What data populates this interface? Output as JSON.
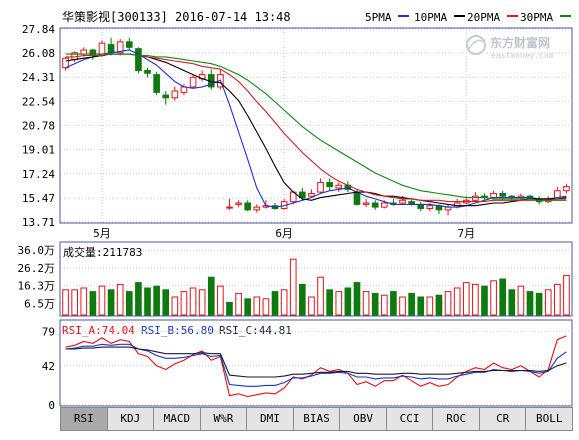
{
  "header": {
    "title": "华策影视[300133] 2016-07-14 13:48",
    "legend": [
      {
        "label": "5PMA",
        "color": "#2233cc"
      },
      {
        "label": "10PMA",
        "color": "#000000"
      },
      {
        "label": "20PMA",
        "color": "#cc2222"
      },
      {
        "label": "30PMA",
        "color": "#118811"
      }
    ],
    "watermark_cn": "东方财富网",
    "watermark_en": "eastmoney.com"
  },
  "colors": {
    "up": "#e0161b",
    "down": "#0f7a0f",
    "rsi_a": "#e01010",
    "rsi_b": "#1c36c6",
    "rsi_c": "#1b1b2e",
    "grid": "#c7cbe0"
  },
  "chart_data": [
    {
      "type": "candlestick",
      "y_ticks": [
        "27.84",
        "26.08",
        "24.31",
        "22.54",
        "20.78",
        "19.01",
        "17.24",
        "15.47",
        "13.71"
      ],
      "ylim": [
        13.71,
        27.84
      ],
      "x_tick_labels": [
        {
          "label": "5月",
          "index": 4
        },
        {
          "label": "6月",
          "index": 24
        },
        {
          "label": "7月",
          "index": 44
        }
      ],
      "candles": [
        [
          25.0,
          25.7,
          25.8,
          24.8
        ],
        [
          25.6,
          26.1,
          26.2,
          25.4
        ],
        [
          26.0,
          26.3,
          26.5,
          25.8
        ],
        [
          26.3,
          25.9,
          26.4,
          25.6
        ],
        [
          25.9,
          26.8,
          27.0,
          25.8
        ],
        [
          26.7,
          26.1,
          27.2,
          25.9
        ],
        [
          26.1,
          26.9,
          27.1,
          25.9
        ],
        [
          26.9,
          26.5,
          27.2,
          26.3
        ],
        [
          26.4,
          24.8,
          26.5,
          24.6
        ],
        [
          24.8,
          24.6,
          25.0,
          24.3
        ],
        [
          24.5,
          23.2,
          24.7,
          23.0
        ],
        [
          23.0,
          22.8,
          23.3,
          22.3
        ],
        [
          22.8,
          23.3,
          23.6,
          22.6
        ],
        [
          23.2,
          23.6,
          23.8,
          23.0
        ],
        [
          23.6,
          24.3,
          24.5,
          23.5
        ],
        [
          24.2,
          24.5,
          24.8,
          24.0
        ],
        [
          24.5,
          23.6,
          24.9,
          23.4
        ],
        [
          23.6,
          24.5,
          24.9,
          23.4
        ],
        [
          14.8,
          14.8,
          15.4,
          14.6
        ],
        [
          15.0,
          15.1,
          15.3,
          14.8
        ],
        [
          15.1,
          14.6,
          15.3,
          14.5
        ],
        [
          14.6,
          14.8,
          15.0,
          14.4
        ],
        [
          14.8,
          14.9,
          15.3,
          14.7
        ],
        [
          14.9,
          14.7,
          15.1,
          14.6
        ],
        [
          14.7,
          15.2,
          15.4,
          14.6
        ],
        [
          15.2,
          15.9,
          16.0,
          15.0
        ],
        [
          15.9,
          15.5,
          16.2,
          15.3
        ],
        [
          15.6,
          15.8,
          16.1,
          15.5
        ],
        [
          15.9,
          16.6,
          16.9,
          15.8
        ],
        [
          16.6,
          16.3,
          16.9,
          16.0
        ],
        [
          16.2,
          16.4,
          16.6,
          15.9
        ],
        [
          16.4,
          16.1,
          16.7,
          15.9
        ],
        [
          15.9,
          15.0,
          16.1,
          14.9
        ],
        [
          15.0,
          15.1,
          15.4,
          14.8
        ],
        [
          15.1,
          14.8,
          15.3,
          14.6
        ],
        [
          14.8,
          15.1,
          15.3,
          14.7
        ],
        [
          15.1,
          15.0,
          15.4,
          14.9
        ],
        [
          15.1,
          15.3,
          15.6,
          15.0
        ],
        [
          15.2,
          15.0,
          15.4,
          14.9
        ],
        [
          15.0,
          14.7,
          15.2,
          14.5
        ],
        [
          14.7,
          14.9,
          15.1,
          14.5
        ],
        [
          14.9,
          14.6,
          15.0,
          14.3
        ],
        [
          14.6,
          14.8,
          15.0,
          14.2
        ],
        [
          14.8,
          15.1,
          15.4,
          14.7
        ],
        [
          15.1,
          15.3,
          15.6,
          15.0
        ],
        [
          15.3,
          15.6,
          15.9,
          15.2
        ],
        [
          15.6,
          15.5,
          15.8,
          15.3
        ],
        [
          15.5,
          15.8,
          16.0,
          15.4
        ],
        [
          15.8,
          15.6,
          16.0,
          15.3
        ],
        [
          15.6,
          15.5,
          15.7,
          15.3
        ],
        [
          15.5,
          15.6,
          15.8,
          15.4
        ],
        [
          15.6,
          15.4,
          15.7,
          15.3
        ],
        [
          15.4,
          15.2,
          15.6,
          15.0
        ],
        [
          15.2,
          15.4,
          15.6,
          15.1
        ],
        [
          15.4,
          16.0,
          16.3,
          15.3
        ],
        [
          16.0,
          16.3,
          16.5,
          15.8
        ]
      ],
      "ma": [
        {
          "name": "5PMA",
          "color": "#2233cc",
          "values": [
            25.0,
            25.3,
            25.6,
            25.8,
            26.0,
            26.1,
            26.2,
            26.3,
            26.0,
            25.6,
            25.2,
            24.6,
            24.0,
            23.6,
            23.5,
            23.6,
            23.8,
            24.1,
            22.3,
            20.3,
            18.3,
            16.2,
            14.9,
            14.8,
            14.9,
            15.1,
            15.3,
            15.5,
            15.8,
            16.0,
            16.1,
            16.2,
            15.9,
            15.6,
            15.4,
            15.2,
            15.0,
            15.0,
            15.0,
            15.0,
            15.0,
            14.9,
            14.8,
            14.8,
            14.9,
            15.1,
            15.3,
            15.5,
            15.5,
            15.5,
            15.5,
            15.5,
            15.4,
            15.4,
            15.5,
            15.6
          ]
        },
        {
          "name": "10PMA",
          "color": "#000000",
          "values": [
            25.5,
            25.6,
            25.7,
            25.8,
            25.9,
            26.0,
            26.0,
            26.0,
            25.9,
            25.8,
            25.6,
            25.4,
            25.1,
            24.8,
            24.5,
            24.2,
            24.0,
            23.9,
            23.3,
            22.6,
            21.5,
            20.3,
            19.1,
            17.8,
            16.6,
            15.9,
            15.4,
            15.3,
            15.5,
            15.6,
            15.7,
            15.8,
            15.9,
            15.9,
            15.8,
            15.6,
            15.6,
            15.5,
            15.4,
            15.3,
            15.2,
            15.1,
            15.0,
            14.9,
            14.9,
            14.9,
            15.0,
            15.1,
            15.1,
            15.2,
            15.3,
            15.4,
            15.4,
            15.4,
            15.4,
            15.5
          ]
        },
        {
          "name": "20PMA",
          "color": "#cc2222",
          "values": [
            25.8,
            25.8,
            25.9,
            25.9,
            25.9,
            26.0,
            26.0,
            26.0,
            25.9,
            25.8,
            25.7,
            25.6,
            25.5,
            25.4,
            25.3,
            25.1,
            25.0,
            24.9,
            24.5,
            24.0,
            23.3,
            22.5,
            21.8,
            21.0,
            20.2,
            19.5,
            18.8,
            18.2,
            17.6,
            17.1,
            16.7,
            16.4,
            16.1,
            15.9,
            15.7,
            15.6,
            15.5,
            15.4,
            15.4,
            15.3,
            15.3,
            15.3,
            15.2,
            15.2,
            15.2,
            15.2,
            15.2,
            15.3,
            15.3,
            15.3,
            15.3,
            15.3,
            15.3,
            15.3,
            15.4,
            15.4
          ]
        },
        {
          "name": "30PMA",
          "color": "#118811",
          "values": [
            26.0,
            26.0,
            26.0,
            26.0,
            26.0,
            26.0,
            26.0,
            26.0,
            25.9,
            25.9,
            25.8,
            25.8,
            25.7,
            25.6,
            25.5,
            25.4,
            25.3,
            25.1,
            24.8,
            24.5,
            24.1,
            23.6,
            23.1,
            22.5,
            21.9,
            21.3,
            20.7,
            20.2,
            19.7,
            19.3,
            18.9,
            18.5,
            18.1,
            17.7,
            17.3,
            17.0,
            16.7,
            16.4,
            16.2,
            16.0,
            15.9,
            15.8,
            15.7,
            15.6,
            15.5,
            15.5,
            15.5,
            15.4,
            15.4,
            15.4,
            15.4,
            15.4,
            15.3,
            15.3,
            15.3,
            15.3
          ]
        }
      ]
    },
    {
      "type": "bar",
      "title": "成交量:211783",
      "y_ticks": [
        "36.0万",
        "26.2万",
        "16.3万",
        "6.5万"
      ],
      "ylim": [
        0,
        40
      ],
      "values": [
        14,
        14,
        15,
        13,
        16,
        14,
        17,
        13,
        18,
        15,
        16,
        14,
        10,
        13,
        15,
        14,
        21,
        16,
        7,
        12,
        9,
        10,
        9,
        13,
        14,
        31,
        17,
        10,
        21,
        14,
        13,
        15,
        18,
        13,
        12,
        11,
        13,
        10,
        12,
        10,
        10,
        11,
        13,
        15,
        18,
        17,
        16,
        19,
        20,
        14,
        16,
        13,
        12,
        14,
        17,
        22
      ],
      "directions": "up,up,up,down,up,down,up,down,down,down,down,down,up,up,up,up,down,up,down,up,down,up,up,down,up,up,down,up,up,down,up,down,down,up,down,up,down,up,down,down,up,down,up,up,up,up,down,up,down,down,up,down,down,up,up,up"
    },
    {
      "type": "line",
      "labels": {
        "a": "RSI_A:74.04",
        "b": "RSI_B:56.80",
        "c": "RSI_C:44.81"
      },
      "y_ticks": [
        "79",
        "42",
        "0"
      ],
      "ylim": [
        0,
        90
      ],
      "series": [
        {
          "name": "RSI_A",
          "color": "#e01010",
          "values": [
            62,
            64,
            68,
            66,
            72,
            66,
            70,
            68,
            55,
            52,
            42,
            38,
            44,
            48,
            54,
            58,
            48,
            52,
            10,
            12,
            9,
            11,
            13,
            12,
            18,
            30,
            28,
            32,
            40,
            36,
            38,
            34,
            22,
            25,
            20,
            26,
            26,
            32,
            26,
            20,
            24,
            20,
            22,
            30,
            36,
            40,
            38,
            45,
            40,
            38,
            42,
            36,
            30,
            38,
            70,
            74
          ]
        },
        {
          "name": "RSI_B",
          "color": "#1c36c6",
          "values": [
            60,
            61,
            63,
            63,
            65,
            64,
            65,
            65,
            60,
            58,
            53,
            50,
            50,
            51,
            53,
            55,
            52,
            53,
            22,
            21,
            20,
            20,
            21,
            21,
            24,
            29,
            29,
            31,
            34,
            34,
            35,
            34,
            30,
            30,
            28,
            29,
            29,
            31,
            30,
            28,
            29,
            28,
            28,
            31,
            33,
            35,
            35,
            38,
            37,
            36,
            37,
            36,
            34,
            36,
            50,
            57
          ]
        },
        {
          "name": "RSI_C",
          "color": "#1b1b2e",
          "values": [
            60,
            60,
            61,
            61,
            62,
            62,
            62,
            62,
            60,
            59,
            57,
            55,
            55,
            55,
            55,
            56,
            55,
            55,
            32,
            31,
            30,
            30,
            30,
            30,
            31,
            33,
            33,
            34,
            35,
            35,
            36,
            36,
            34,
            34,
            33,
            33,
            33,
            34,
            34,
            33,
            33,
            33,
            33,
            34,
            35,
            36,
            36,
            37,
            37,
            37,
            37,
            37,
            36,
            37,
            42,
            45
          ]
        }
      ]
    }
  ],
  "tabs": [
    "RSI",
    "KDJ",
    "MACD",
    "W%R",
    "DMI",
    "BIAS",
    "OBV",
    "CCI",
    "ROC",
    "CR",
    "BOLL"
  ],
  "active_tab": "RSI"
}
